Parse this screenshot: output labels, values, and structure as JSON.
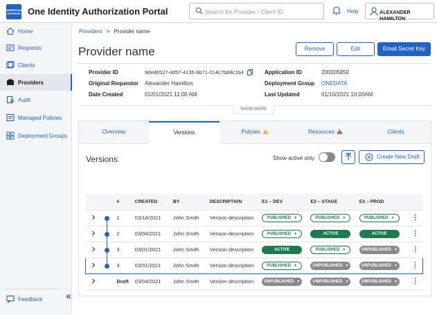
{
  "header": {
    "logo_text": "AMERICAN EXPRESS",
    "app_title": "One Identity Authorization Portal",
    "search_placeholder": "Search for Provider / Client ID",
    "help_label": "Help",
    "user_name": "ALEXANDER HAMILTON"
  },
  "sidebar": {
    "items": [
      {
        "label": "Home",
        "icon": "home-icon"
      },
      {
        "label": "Requests",
        "icon": "requests-icon"
      },
      {
        "label": "Clients",
        "icon": "clients-icon"
      },
      {
        "label": "Providers",
        "icon": "providers-icon",
        "active": true
      },
      {
        "label": "Audit",
        "icon": "audit-icon"
      },
      {
        "label": "Managed Policies",
        "icon": "policies-icon"
      },
      {
        "label": "Deployment Groups",
        "icon": "groups-icon"
      }
    ],
    "feedback_label": "Feedback",
    "collapse_glyph": "«"
  },
  "breadcrumb": {
    "parent": "Providers",
    "separator": ">",
    "current": "Provider name"
  },
  "page": {
    "title": "Provider name",
    "remove_label": "Remove",
    "edit_label": "Edit",
    "email_label": "Email Secret Key"
  },
  "details": {
    "provider_id_label": "Provider ID",
    "provider_id": "9ded6527-dd57-4135-bb71-014c7b88c1b4",
    "requestor_label": "Original Requestor",
    "requestor": "Alexander Hamilton",
    "created_label": "Date Created",
    "created": "01/01/2021 11:00 AM",
    "app_id_label": "Application ID",
    "app_id": "200005050",
    "group_label": "Deployment Group",
    "group": "ONEDATA",
    "updated_label": "Last Updated",
    "updated": "01/10/2021 10:00AM",
    "show_more": "SHOW MORE"
  },
  "tabs": [
    {
      "label": "Overview"
    },
    {
      "label": "Versions",
      "active": true
    },
    {
      "label": "Policies",
      "warning": "amber"
    },
    {
      "label": "Resources",
      "warning": "red"
    },
    {
      "label": "Clients"
    }
  ],
  "versions": {
    "title": "Versions",
    "show_active_label": "Show active only",
    "new_draft_label": "Create New Draft",
    "columns": [
      "#",
      "CREATED",
      "BY",
      "DESCRIPTION",
      "E1 – DEV",
      "E2 – STAGE",
      "E3 – PROD"
    ],
    "rows": [
      {
        "num": "1",
        "created": "03/14/2021",
        "by": "John Smith",
        "desc": "Version description",
        "e1": "PUBLISHED",
        "e2": "PUBLISHED",
        "e3": "PUBLISHED"
      },
      {
        "num": "2",
        "created": "03/04/2021",
        "by": "John Smith",
        "desc": "Version description",
        "e1": "PUBLISHED",
        "e2": "ACTIVE",
        "e3": "ACTIVE"
      },
      {
        "num": "3",
        "created": "03/01/2021",
        "by": "John Smith",
        "desc": "Version description",
        "e1": "ACTIVE",
        "e2": "PUBLISHED",
        "e3": "UNPUBLISHED"
      },
      {
        "num": "4",
        "created": "03/01/2021",
        "by": "John Smith",
        "desc": "Version description",
        "e1": "PUBLISHED",
        "e2": "UNPUBLISHED",
        "e3": "UNPUBLISHED",
        "selected": true
      },
      {
        "num": "Draft",
        "created": "03/04/2021",
        "by": "John Smith",
        "desc": "Version description",
        "e1": "UNPUBLISHED",
        "e2": "UNPUBLISHED",
        "e3": "UNPUBLISHED"
      }
    ]
  },
  "colors": {
    "brand": "#1f63c6",
    "success": "#1d7a4e",
    "muted": "#8a8a8a",
    "warn_amber": "#f0a020",
    "warn_red": "#c0392b"
  }
}
